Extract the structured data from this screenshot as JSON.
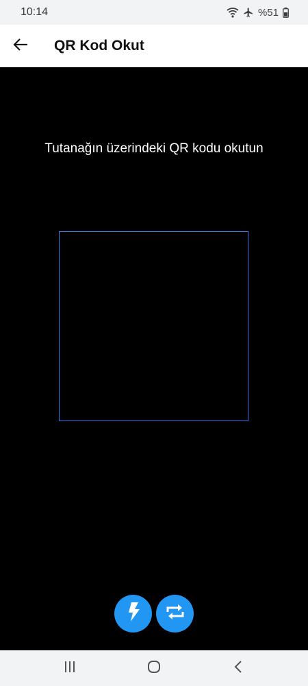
{
  "status_bar": {
    "time": "10:14",
    "battery": "%51",
    "icons": [
      "wifi-icon",
      "airplane-icon",
      "battery-icon"
    ]
  },
  "app_bar": {
    "title": "QR Kod Okut",
    "back_icon": "arrow-left-icon"
  },
  "scanner": {
    "instruction": "Tutanağın üzerindeki QR kodu okutun",
    "frame_color": "#2f7bea",
    "buttons": [
      {
        "name": "flash-button",
        "icon": "flash-icon"
      },
      {
        "name": "switch-camera-button",
        "icon": "camera-switch-icon"
      }
    ],
    "button_color": "#2196f3"
  },
  "nav_bar": {
    "buttons": [
      "recents-icon",
      "home-icon",
      "back-icon"
    ]
  }
}
